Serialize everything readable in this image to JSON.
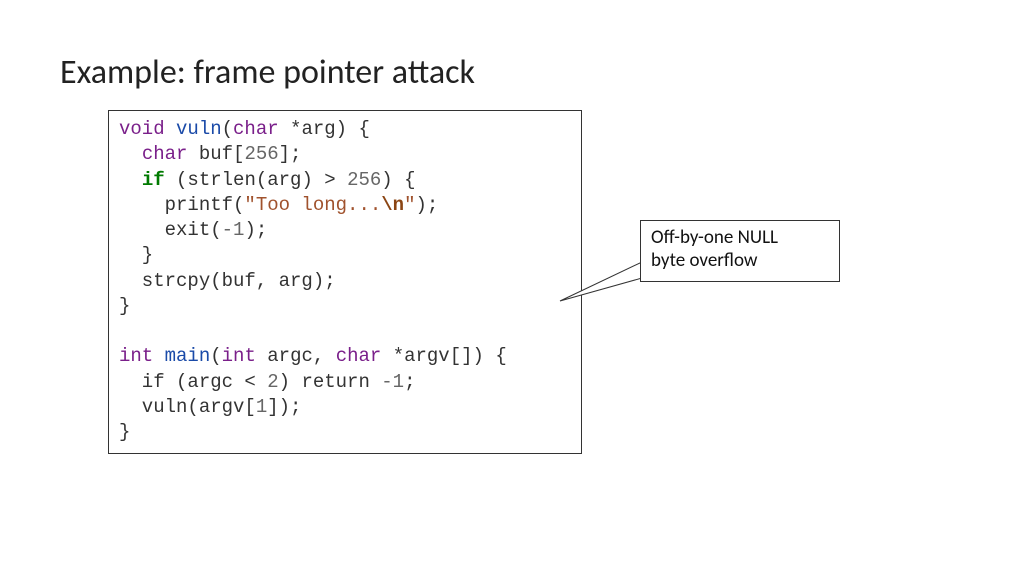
{
  "title": "Example: frame pointer attack",
  "code": {
    "l01a": "void",
    "l01b": " ",
    "l01c": "vuln",
    "l01d": "(",
    "l01e": "char",
    "l01f": " *arg) {",
    "l02a": "  ",
    "l02b": "char",
    "l02c": " buf[",
    "l02d": "256",
    "l02e": "];",
    "l03a": "  ",
    "l03b": "if",
    "l03c": " (strlen(arg) > ",
    "l03d": "256",
    "l03e": ") {",
    "l04a": "    printf(",
    "l04b": "\"Too long...",
    "l04c": "\\n",
    "l04d": "\"",
    "l04e": ");",
    "l05a": "    exit(",
    "l05b": "-1",
    "l05c": ");",
    "l06": "  }",
    "l07": "  strcpy(buf, arg);",
    "l08": "}",
    "blank": "",
    "l10a": "int",
    "l10b": " ",
    "l10c": "main",
    "l10d": "(",
    "l10e": "int",
    "l10f": " argc, ",
    "l10g": "char",
    "l10h": " *argv[]) {",
    "l11a": "  if (argc < ",
    "l11b": "2",
    "l11c": ") return ",
    "l11d": "-1",
    "l11e": ";",
    "l12a": "  vuln(argv[",
    "l12b": "1",
    "l12c": "]);",
    "l13": "}"
  },
  "callout": {
    "line1": "Off-by-one NULL",
    "line2": "byte overflow"
  }
}
